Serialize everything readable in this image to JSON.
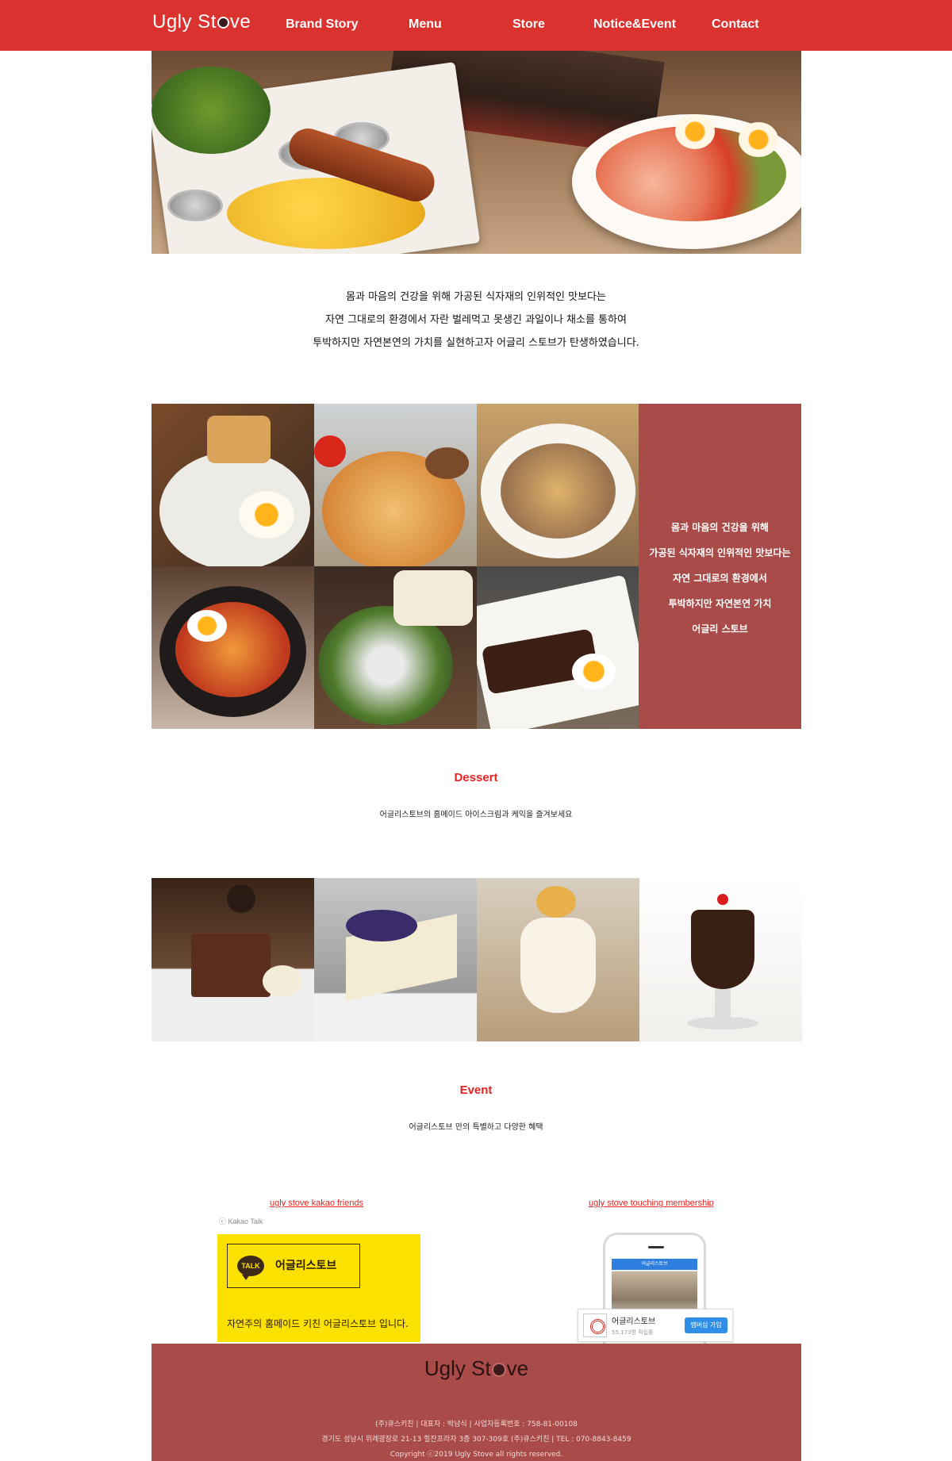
{
  "header": {
    "logo_prefix": "Ugly St",
    "logo_suffix": "ve",
    "nav": [
      {
        "label": "Brand Story"
      },
      {
        "label": "Menu"
      },
      {
        "label": "Store"
      },
      {
        "label": "Notice&Event"
      },
      {
        "label": "Contact"
      }
    ]
  },
  "intro": {
    "lines": [
      "몸과 마음의 건강을 위해 가공된 식자재의 인위적인 맛보다는",
      "자연 그대로의 환경에서 자란 벌레먹고 못생긴 과일이나 채소를 통하여",
      "투박하지만 자연본연의 가치를 실현하고자 어글리 스토브가 탄생하였습니다."
    ]
  },
  "menu_panel": {
    "lines": [
      "몸과 마음의 건강을 위해",
      "가공된 식자재의 인위적인 맛보다는",
      "자연 그대로의 환경에서",
      "투박하지만 자연본연 가치",
      "어글리 스토브"
    ]
  },
  "dessert": {
    "title": "Dessert",
    "subtitle": "어글리스토브의 홈메이드 아이스크림과 케익을 즐겨보세요"
  },
  "event": {
    "title": "Event",
    "subtitle": "어글리스토브 만의 특별하고 다양한 혜택"
  },
  "kakao": {
    "link": "ugly stove kakao friends",
    "credit": "ⓒ Kakao Talk",
    "talk_badge": "TALK",
    "name": "어글리스토브",
    "desc": "자연주의 홈메이드 키친 어글리스토브 입니다."
  },
  "membership": {
    "link": "ugly stove touching membership",
    "screen_title": "어글리스토브",
    "card_name": "어글리스토브",
    "card_count": "55,173명 적립중",
    "join_label": "멤버십 가입"
  },
  "footer": {
    "logo_prefix": "Ugly St",
    "logo_suffix": "ve",
    "line1": "(주)큐스키친 | 대표자 : 박남식 | 사업자등록번호 : 758-81-00108",
    "line2": "경기도 성남시 위례광장로 21-13 힐잔프라자 3층 307-309호 (주)큐스키친 | TEL : 070-8843-8459",
    "line3": "Copyright ⓒ2019 Ugly Stove all rights reserved."
  },
  "colors": {
    "brand_red": "#d9322f",
    "panel": "#a84b49",
    "accent_text": "#e52320"
  }
}
